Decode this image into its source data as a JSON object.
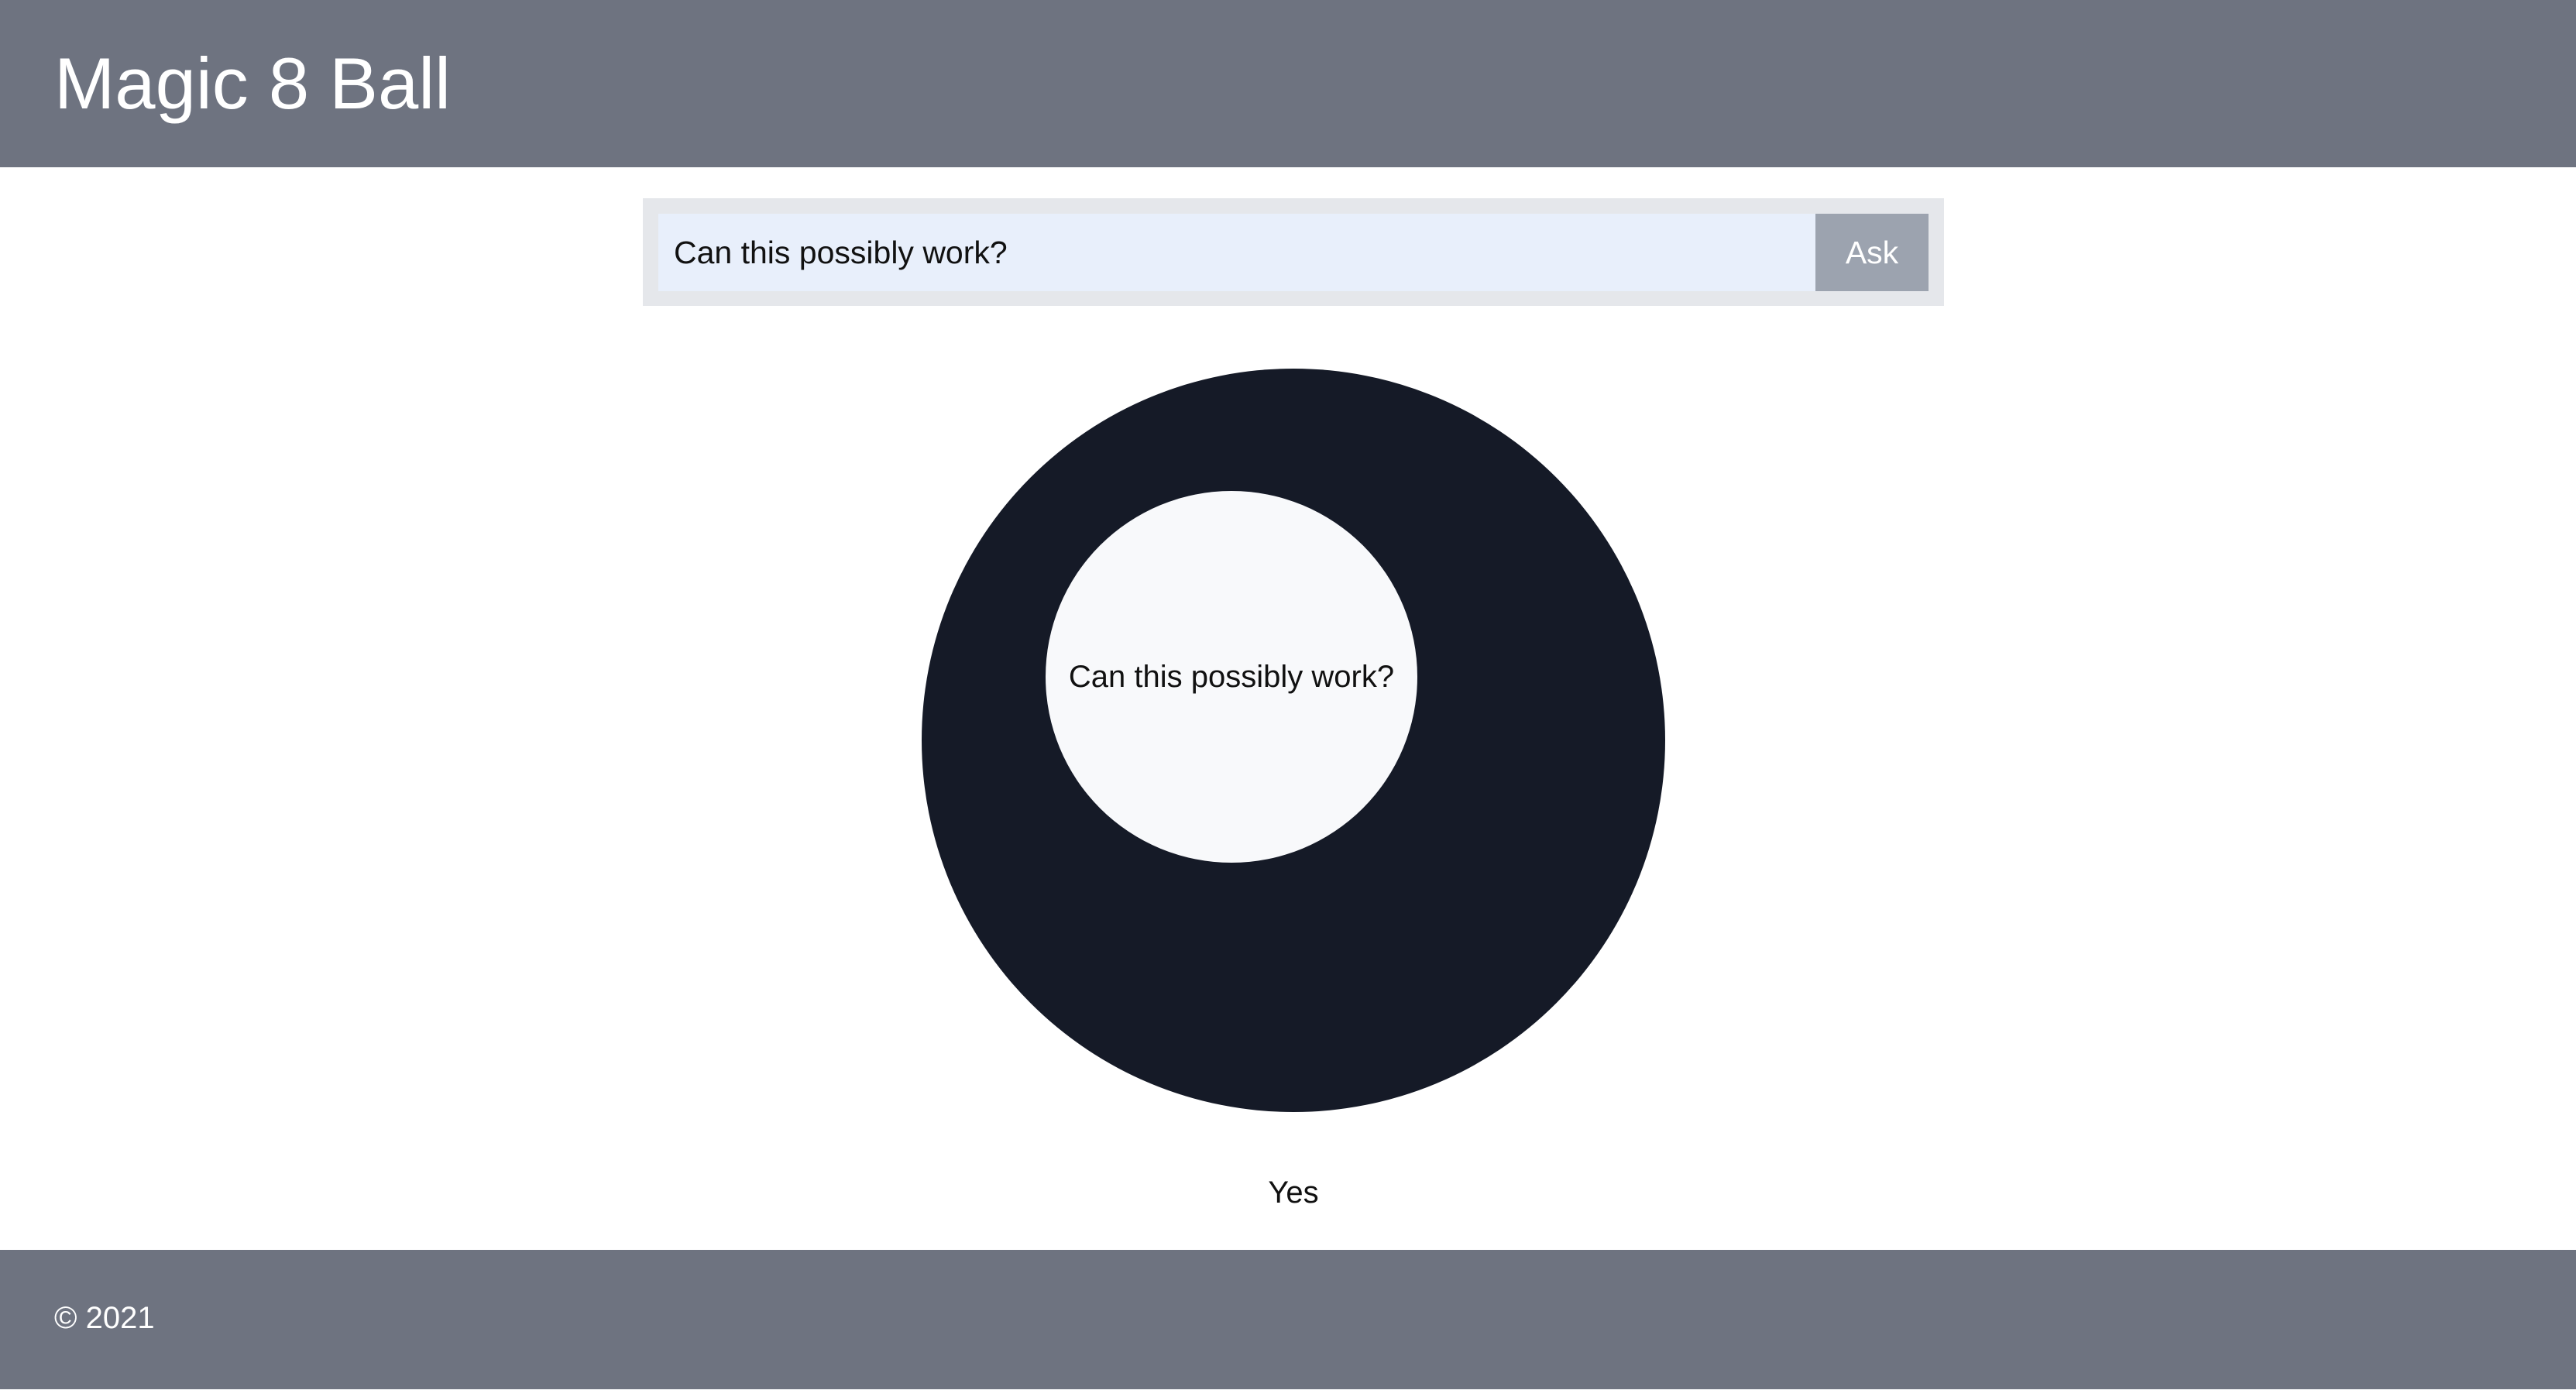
{
  "header": {
    "title": "Magic 8 Ball"
  },
  "form": {
    "question_value": "Can this possibly work?",
    "ask_label": "Ask"
  },
  "ball": {
    "window_text": "Can this possibly work?",
    "answer": "Yes"
  },
  "footer": {
    "copyright": "© 2021"
  },
  "colors": {
    "header_bg": "#6e7380",
    "footer_bg": "#6e7380",
    "ball": "#151a27",
    "window": "#f8f9fb",
    "input_bg": "#e8effb",
    "button_bg": "#9ca3af",
    "form_bg": "#e5e7eb"
  }
}
